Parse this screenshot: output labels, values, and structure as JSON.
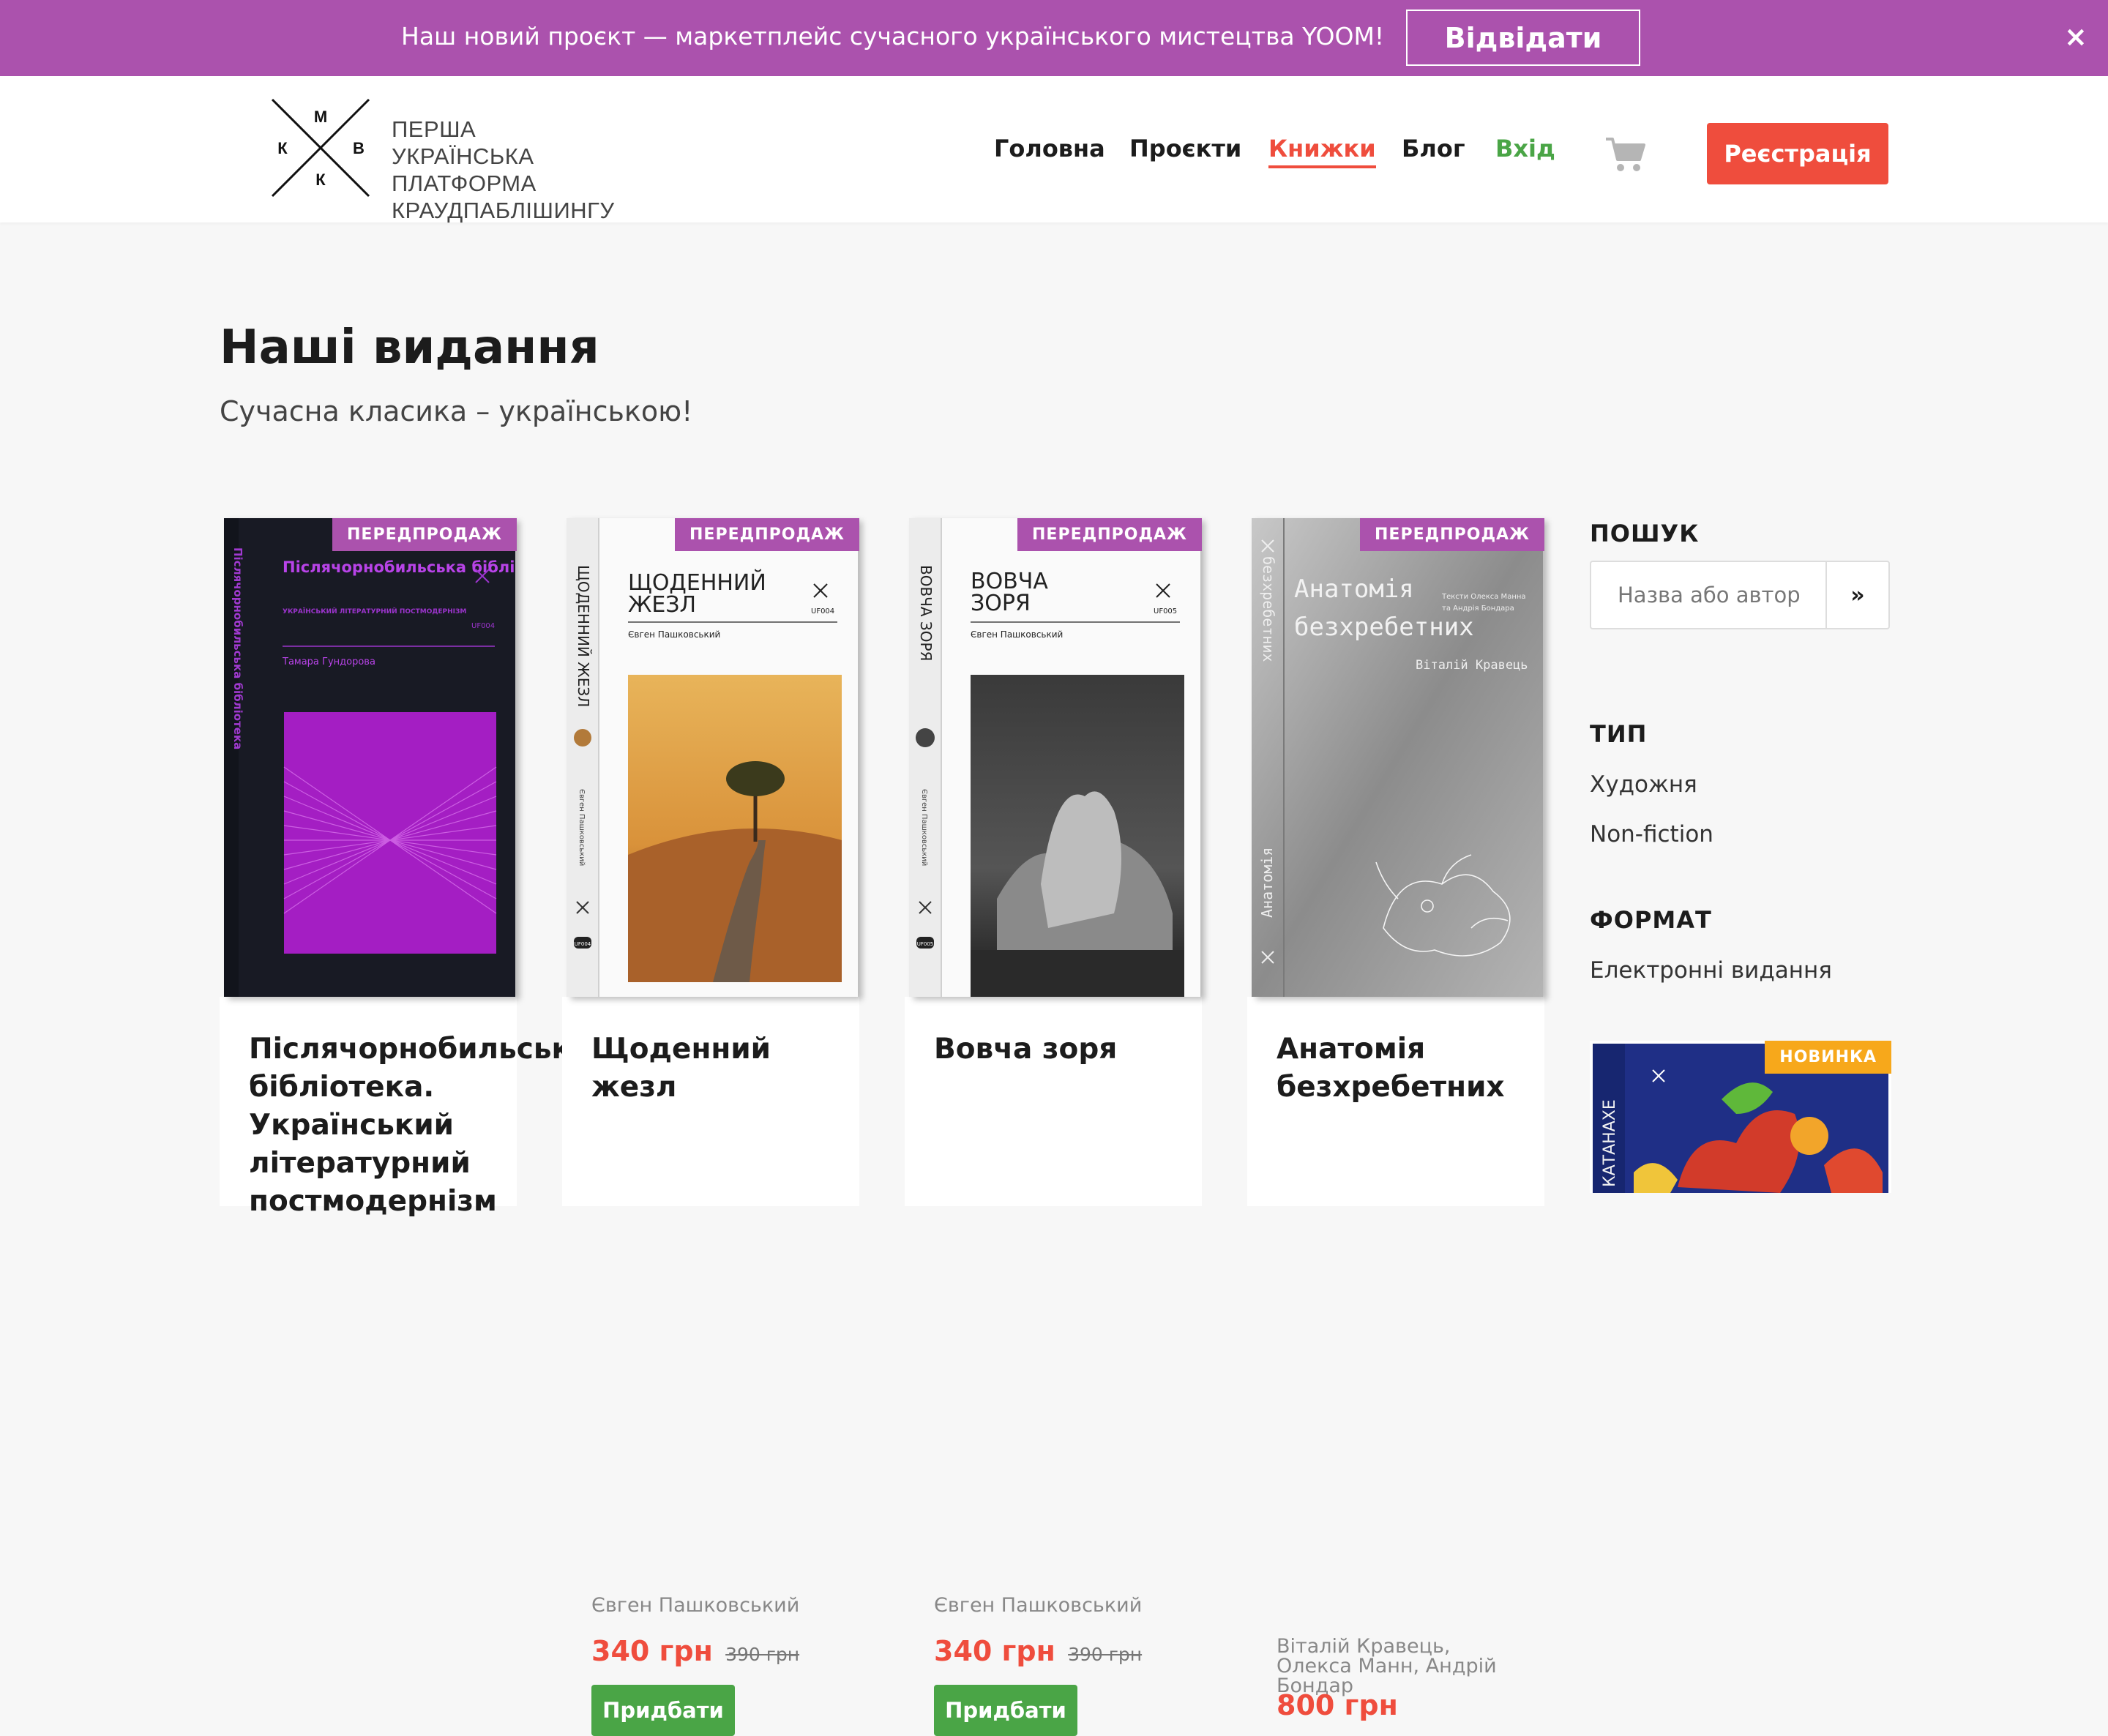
{
  "promo": {
    "text": "Наш новий проєкт — маркетплейс сучасного українського мистецтва YOOM!",
    "button": "Відвідати",
    "close": "×"
  },
  "logo": {
    "letters": [
      "М",
      "К",
      "В",
      "К"
    ],
    "lines": [
      "ПЕРША",
      "УКРАЇНСЬКА",
      "ПЛАТФОРМА",
      "КРАУДПАБЛІШИНГУ"
    ]
  },
  "nav": {
    "home": "Головна",
    "projects": "Проєкти",
    "books": "Книжки",
    "blog": "Блог",
    "login": "Вхід",
    "cart_icon": "cart-icon",
    "register": "Реєстрація"
  },
  "page": {
    "title": "Наші видання",
    "subtitle": "Сучасна класика – українською!"
  },
  "books": [
    {
      "badge": "ПЕРЕДПРОДАЖ",
      "title": "Післячорнобильська бібліотека. Український літературний постмодернізм",
      "cover": {
        "title": "Післячорнобильська бібліотека",
        "subtitle": "УКРАЇНСЬКИЙ ЛІТЕРАТУРНИЙ ПОСТМОДЕРНІЗМ",
        "code": "UF004",
        "author": "Тамара Гундорова",
        "spine": "Післячорнобильська бібліотека"
      }
    },
    {
      "badge": "ПЕРЕДПРОДАЖ",
      "title": "Щоденний жезл",
      "author": "Євген Пашковський",
      "price": "340 грн",
      "old_price": "390 грн",
      "buy": "Придбати",
      "cover": {
        "title_line1": "ЩОДЕННИЙ",
        "title_line2": "ЖЕЗЛ",
        "code": "UF004",
        "author": "Євген Пашковський",
        "spine": "ЩОДЕННИЙ ЖЕЗЛ",
        "spine_author": "Євген Пашковський",
        "spine_code": "UF004"
      }
    },
    {
      "badge": "ПЕРЕДПРОДАЖ",
      "title": "Вовча зоря",
      "author": "Євген Пашковський",
      "price": "340 грн",
      "old_price": "390 грн",
      "buy": "Придбати",
      "cover": {
        "title_line1": "ВОВЧА",
        "title_line2": "ЗОРЯ",
        "code": "UF005",
        "author": "Євген Пашковський",
        "spine": "ВОВЧА ЗОРЯ",
        "spine_author": "Євген Пашковський",
        "spine_code": "UF005"
      }
    },
    {
      "badge": "ПЕРЕДПРОДАЖ",
      "title": "Анатомія безхребетних",
      "author": "Віталій Кравець, Олекса Манн, Андрій Бондар",
      "price": "800 грн",
      "cover": {
        "title_line1": "Анатомія",
        "title_line2": "безхребетних",
        "author": "Віталій Кравець",
        "note_line1": "Тексти Олекса Манна",
        "note_line2": "та Андрія Бондара",
        "spine": "безхребетних",
        "spine_bottom": "Анатомія"
      }
    }
  ],
  "sidebar": {
    "search_heading": "ПОШУК",
    "search_placeholder": "Назва або автор",
    "search_button": "»",
    "type_heading": "ТИП",
    "type_options": [
      "Художня",
      "Non-fiction"
    ],
    "format_heading": "ФОРМАТ",
    "format_options": [
      "Електронні видання"
    ],
    "featured": {
      "badge": "НОВИНКА",
      "spine": "КАТАНАХЕ"
    }
  }
}
